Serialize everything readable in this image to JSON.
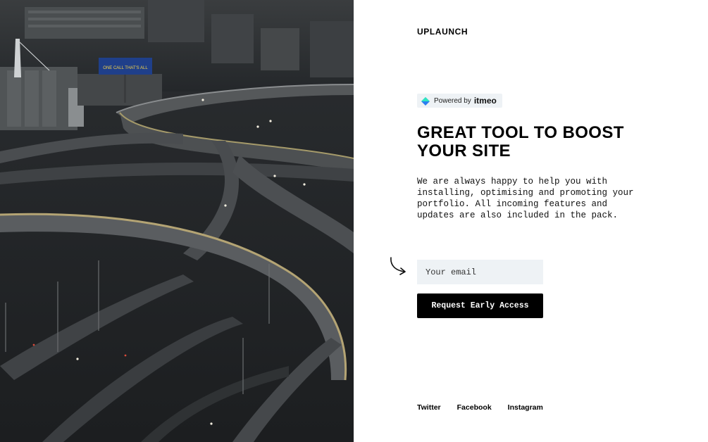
{
  "photo": {
    "alt": "Elevated highway interchange at dusk",
    "billboard_text": "ONE CALL THAT'S ALL"
  },
  "brand": {
    "name": "UPLAUNCH"
  },
  "powered_by": {
    "prefix": "Powered by",
    "brand": "itmeo",
    "icon": "itmeo-diamond-icon"
  },
  "hero": {
    "headline": "GREAT TOOL TO BOOST YOUR SITE",
    "description": "We are always happy to help you with installing, optimising and promoting your portfolio. All incoming features and updates are also included in the pack."
  },
  "form": {
    "email_placeholder": "Your email",
    "email_value": "",
    "submit_label": "Request Early Access",
    "pointer_icon": "curved-arrow-icon"
  },
  "social": {
    "links": [
      {
        "label": "Twitter"
      },
      {
        "label": "Facebook"
      },
      {
        "label": "Instagram"
      }
    ]
  },
  "colors": {
    "background": "#ffffff",
    "text": "#000000",
    "input_bg": "#eef2f5",
    "button_bg": "#000000",
    "button_text": "#ffffff",
    "badge_diamond_top": "#2ee6c0",
    "badge_diamond_bottom": "#2b7ff0"
  }
}
